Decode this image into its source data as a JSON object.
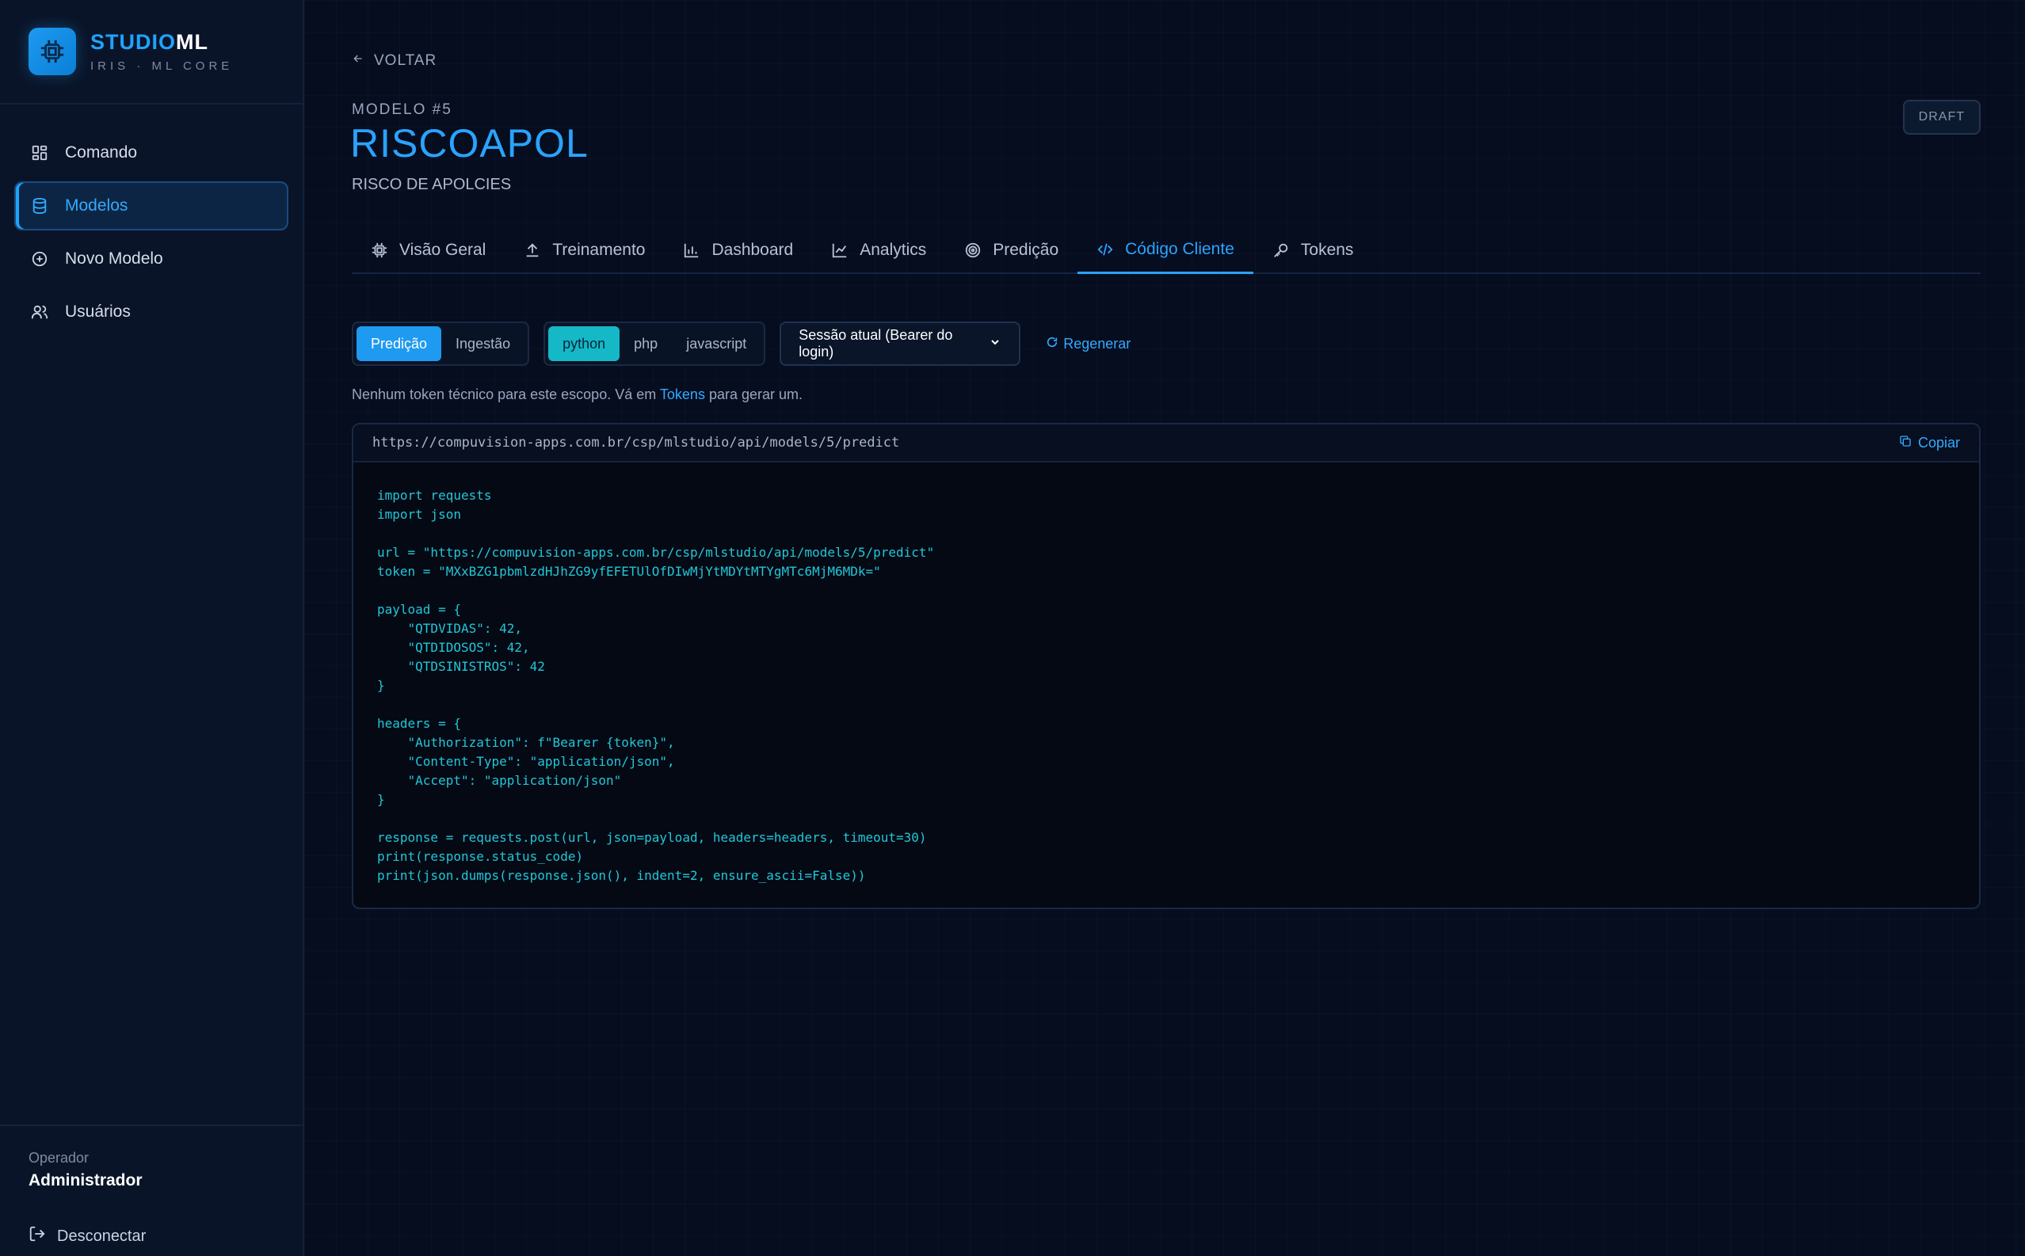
{
  "brand": {
    "title_a": "STUDIO",
    "title_b": "ML",
    "subtitle": "IRIS · ML CORE"
  },
  "sidebar": {
    "items": [
      {
        "label": "Comando",
        "icon": "grid-icon"
      },
      {
        "label": "Modelos",
        "icon": "database-icon",
        "active": true
      },
      {
        "label": "Novo Modelo",
        "icon": "plus-circle-icon"
      },
      {
        "label": "Usuários",
        "icon": "users-icon"
      }
    ],
    "operator_label": "Operador",
    "operator_name": "Administrador",
    "logout_label": "Desconectar"
  },
  "header": {
    "back_label": "VOLTAR",
    "model_number": "MODELO #5",
    "model_title": "RISCOAPOL",
    "model_description": "RISCO DE APOLCIES",
    "status_badge": "DRAFT"
  },
  "tabs": [
    {
      "label": "Visão Geral",
      "icon": "chip-icon"
    },
    {
      "label": "Treinamento",
      "icon": "upload-icon"
    },
    {
      "label": "Dashboard",
      "icon": "bar-chart-icon"
    },
    {
      "label": "Analytics",
      "icon": "line-chart-icon"
    },
    {
      "label": "Predição",
      "icon": "target-icon"
    },
    {
      "label": "Código Cliente",
      "icon": "code-icon",
      "active": true
    },
    {
      "label": "Tokens",
      "icon": "key-icon"
    }
  ],
  "controls": {
    "scope": {
      "options": [
        "Predição",
        "Ingestão"
      ],
      "selected": "Predição"
    },
    "language": {
      "options": [
        "python",
        "php",
        "javascript"
      ],
      "selected": "python"
    },
    "auth_select": "Sessão atual (Bearer do login)",
    "regen_label": "Regenerar"
  },
  "hint": {
    "before": "Nenhum token técnico para este escopo. Vá em ",
    "link": "Tokens",
    "after": " para gerar um."
  },
  "code_panel": {
    "url": "https://compuvision-apps.com.br/csp/mlstudio/api/models/5/predict",
    "copy_label": "Copiar",
    "code": "import requests\nimport json\n\nurl = \"https://compuvision-apps.com.br/csp/mlstudio/api/models/5/predict\"\ntoken = \"MXxBZG1pbmlzdHJhZG9yfEFETUlOfDIwMjYtMDYtMTYgMTc6MjM6MDk=\"\n\npayload = {\n    \"QTDVIDAS\": 42,\n    \"QTDIDOSOS\": 42,\n    \"QTDSINISTROS\": 42\n}\n\nheaders = {\n    \"Authorization\": f\"Bearer {token}\",\n    \"Content-Type\": \"application/json\",\n    \"Accept\": \"application/json\"\n}\n\nresponse = requests.post(url, json=payload, headers=headers, timeout=30)\nprint(response.status_code)\nprint(json.dumps(response.json(), indent=2, ensure_ascii=False))"
  },
  "colors": {
    "accent": "#1fa3ff",
    "teal": "#14b8c6",
    "background": "#060d1f",
    "sidebar": "#0a1428"
  }
}
